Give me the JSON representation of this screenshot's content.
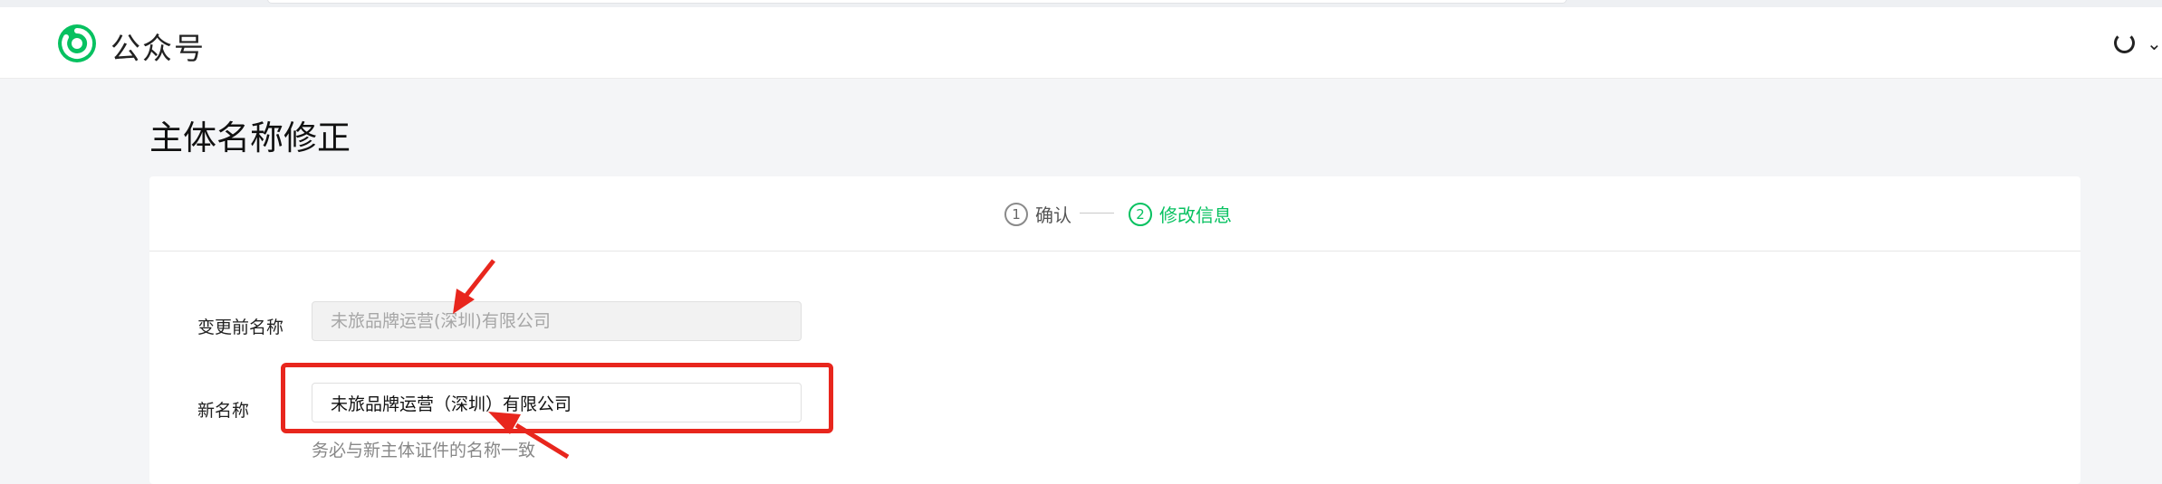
{
  "header": {
    "app_name": "公众号",
    "logo_icon": "wechat-official-account-logo",
    "status_icon": "loading-spinner-icon",
    "menu_icon": "chevron-down-icon"
  },
  "page": {
    "title": "主体名称修正"
  },
  "steps": [
    {
      "num": "1",
      "label": "确认",
      "state": "done"
    },
    {
      "num": "2",
      "label": "修改信息",
      "state": "active"
    }
  ],
  "form": {
    "old_name_label": "变更前名称",
    "old_name_value": "未旅品牌运营(深圳)有限公司",
    "new_name_label": "新名称",
    "new_name_value": "未旅品牌运营（深圳）有限公司",
    "new_name_hint": "务必与新主体证件的名称一致"
  },
  "colors": {
    "accent": "#07c160",
    "annotation": "#e8261d"
  }
}
